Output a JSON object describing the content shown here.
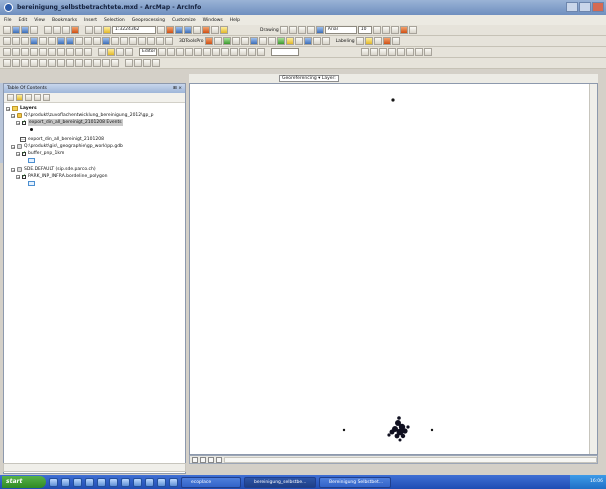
{
  "window": {
    "title": "bereinigung_selbstbetrachtete.mxd - ArcMap - ArcInfo",
    "accent": "#6f8fbf"
  },
  "menu": [
    "File",
    "Edit",
    "View",
    "Bookmarks",
    "Insert",
    "Selection",
    "Geoprocessing",
    "Customize",
    "Windows",
    "Help"
  ],
  "toolbars": {
    "scale": "1:3224362",
    "drawing_label": "Drawing",
    "font_name": "Arial",
    "font_size": "10",
    "editor_label": "Editor",
    "georef_label": "Georeferencing",
    "labeling_label": "Labeling",
    "tools_label": "3DToolsPro"
  },
  "toc": {
    "title": "Table Of Contents",
    "root": "Layers",
    "items": [
      {
        "label": "Q:\\produkt\\zuvoflachentwicklung_bereinigung_2012\\gp_p",
        "type": "folder"
      },
      {
        "label": "export_din_all_bereinigt_2101208 Events",
        "type": "layer",
        "selected": true
      },
      {
        "label": "export_din_all_bereinigt_2101208",
        "type": "table"
      },
      {
        "label": "Q:\\produkt\\gis\\_geographie\\gp_work\\pp.gdb",
        "type": "folder"
      },
      {
        "label": "buffer_pnp_1km",
        "type": "layer"
      },
      {
        "label": "SDE.DEFAULT (sip.sde.parco.ch)",
        "type": "folder"
      },
      {
        "label": "PARK_INP_INFRA.bordeline_polygon",
        "type": "layer"
      }
    ],
    "pin_icon": "pin-icon"
  },
  "map": {
    "layer_dropdown": "Georeferencing ▾ Layer:",
    "bottom_controls": [
      "layout",
      "data",
      "refresh",
      "pause"
    ]
  },
  "taskbar": {
    "start_label": "start",
    "tasks": [
      "ecoplace",
      "bereinigung_selbstbe...",
      "Bereinigung Selbstbet..."
    ],
    "clock": "16:06"
  }
}
